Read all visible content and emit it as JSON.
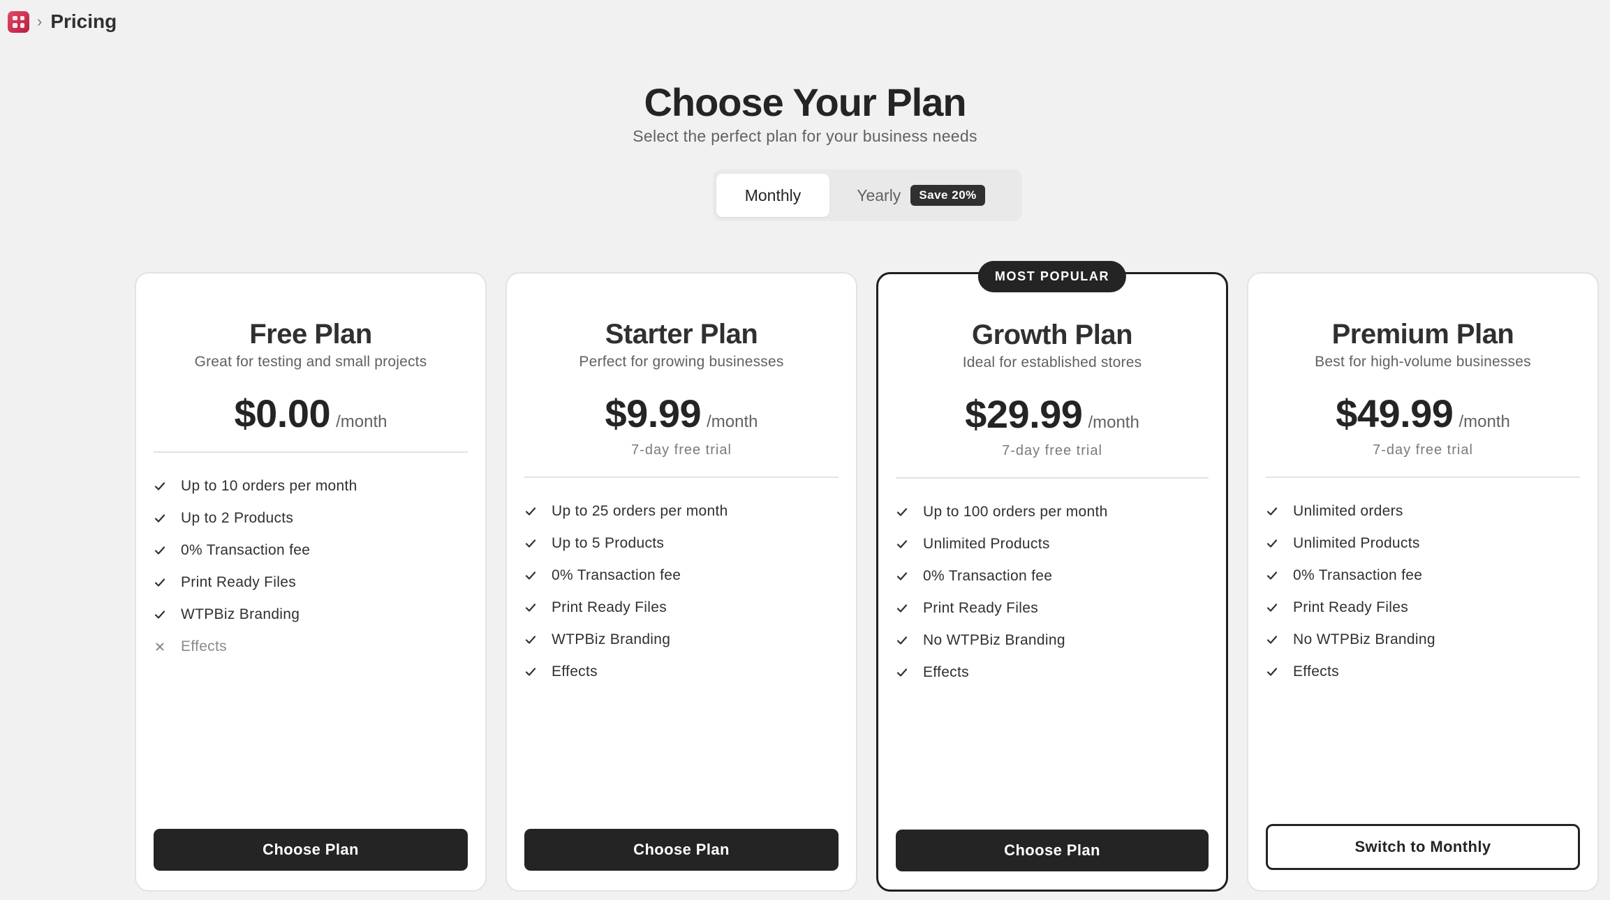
{
  "breadcrumb": {
    "app_icon": "app-grid-icon",
    "title": "Pricing"
  },
  "header": {
    "title": "Choose Your Plan",
    "subtitle": "Select the perfect plan for your business needs"
  },
  "billing_toggle": {
    "monthly_label": "Monthly",
    "yearly_label": "Yearly",
    "save_badge": "Save 20%",
    "selected": "Monthly"
  },
  "plans": [
    {
      "name": "Free Plan",
      "description": "Great for testing and small projects",
      "price": "$0.00",
      "period": "/month",
      "features": [
        {
          "text": "Up to 10 orders per month",
          "included": true
        },
        {
          "text": "Up to 2 Products",
          "included": true
        },
        {
          "text": "0% Transaction fee",
          "included": true
        },
        {
          "text": "Print Ready Files",
          "included": true
        },
        {
          "text": "WTPBiz Branding",
          "included": true
        },
        {
          "text": "Effects",
          "included": false
        }
      ],
      "cta": "Choose Plan"
    },
    {
      "name": "Starter Plan",
      "description": "Perfect for growing businesses",
      "price": "$9.99",
      "period": "/month",
      "trial": "7-day free trial",
      "features": [
        {
          "text": "Up to 25 orders per month",
          "included": true
        },
        {
          "text": "Up to 5 Products",
          "included": true
        },
        {
          "text": "0% Transaction fee",
          "included": true
        },
        {
          "text": "Print Ready Files",
          "included": true
        },
        {
          "text": "WTPBiz Branding",
          "included": true
        },
        {
          "text": "Effects",
          "included": true
        }
      ],
      "cta": "Choose Plan"
    },
    {
      "name": "Growth Plan",
      "description": "Ideal for established stores",
      "price": "$29.99",
      "period": "/month",
      "trial": "7-day free trial",
      "badge": "MOST POPULAR",
      "features": [
        {
          "text": "Up to 100 orders per month",
          "included": true
        },
        {
          "text": "Unlimited Products",
          "included": true
        },
        {
          "text": "0% Transaction fee",
          "included": true
        },
        {
          "text": "Print Ready Files",
          "included": true
        },
        {
          "text": "No WTPBiz Branding",
          "included": true
        },
        {
          "text": "Effects",
          "included": true
        }
      ],
      "cta": "Choose Plan"
    },
    {
      "name": "Premium Plan",
      "description": "Best for high-volume businesses",
      "price": "$49.99",
      "period": "/month",
      "trial": "7-day free trial",
      "features": [
        {
          "text": "Unlimited orders",
          "included": true
        },
        {
          "text": "Unlimited Products",
          "included": true
        },
        {
          "text": "0% Transaction fee",
          "included": true
        },
        {
          "text": "Print Ready Files",
          "included": true
        },
        {
          "text": "No WTPBiz Branding",
          "included": true
        },
        {
          "text": "Effects",
          "included": true
        }
      ],
      "cta": "Switch to Monthly"
    }
  ]
}
